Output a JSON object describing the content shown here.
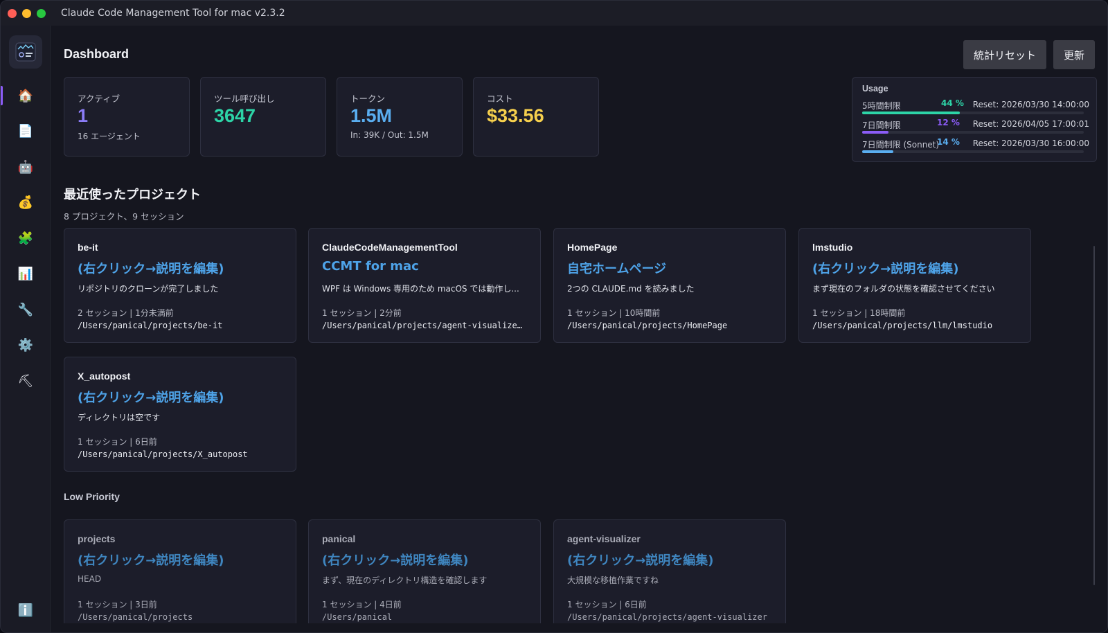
{
  "window": {
    "title": "Claude Code Management Tool for mac v2.3.2",
    "traffic_lights": {
      "close": "#ff5f57",
      "minimize": "#febc2e",
      "zoom": "#28c840"
    }
  },
  "sidebar": {
    "items": [
      {
        "icon": "home-icon",
        "glyph": "🏠",
        "active": true
      },
      {
        "icon": "document-icon",
        "glyph": "📄"
      },
      {
        "icon": "robot-icon",
        "glyph": "🤖"
      },
      {
        "icon": "money-bag-icon",
        "glyph": "💰"
      },
      {
        "icon": "puzzle-icon",
        "glyph": "🧩"
      },
      {
        "icon": "bar-chart-icon",
        "glyph": "📊"
      },
      {
        "icon": "wrench-icon",
        "glyph": "🔧"
      },
      {
        "icon": "gear-icon",
        "glyph": "⚙️"
      },
      {
        "icon": "hammer-pick-icon",
        "glyph": "⛏"
      }
    ],
    "info": {
      "icon": "info-icon",
      "glyph": "ℹ️"
    }
  },
  "header": {
    "title": "Dashboard",
    "reset_stats_label": "統計リセット",
    "refresh_label": "更新"
  },
  "stats": {
    "active": {
      "label": "アクティブ",
      "value": "1",
      "sub": "16 エージェント",
      "color": "#8b7cf6"
    },
    "tool_calls": {
      "label": "ツール呼び出し",
      "value": "3647",
      "color": "#2dd4a7"
    },
    "tokens": {
      "label": "トークン",
      "value": "1.5M",
      "sub": "In: 39K / Out: 1.5M",
      "color": "#5aaef0"
    },
    "cost": {
      "label": "コスト",
      "value": "$33.56",
      "color": "#f6d04d"
    }
  },
  "usage": {
    "title": "Usage",
    "rows": [
      {
        "label": "5時間制限",
        "percent_text": "44 %",
        "percent": 44,
        "reset": "Reset: 2026/03/30 14:00:00",
        "color": "#2dd4a7"
      },
      {
        "label": "7日間制限",
        "percent_text": "12 %",
        "percent": 12,
        "reset": "Reset: 2026/04/05 17:00:01",
        "color": "#8b5cf6"
      },
      {
        "label": "7日間制限 (Sonnet)",
        "percent_text": "14 %",
        "percent": 14,
        "reset": "Reset: 2026/03/30 16:00:00",
        "color": "#5aaef0"
      }
    ]
  },
  "recent": {
    "title": "最近使ったプロジェクト",
    "subtitle": "8 プロジェクト、9 セッション",
    "projects": [
      {
        "name": "be-it",
        "description": "(右クリック→説明を編集)",
        "message": "リポジトリのクローンが完了しました",
        "meta": "2 セッション | 1分未満前",
        "path": "/Users/panical/projects/be-it"
      },
      {
        "name": "ClaudeCodeManagementTool",
        "description": "CCMT for mac",
        "message": "WPF は Windows 専用のため macOS では動作し...",
        "meta": "1 セッション | 2分前",
        "path": "/Users/panical/projects/agent-visualize…"
      },
      {
        "name": "HomePage",
        "description": "自宅ホームページ",
        "message": "2つの CLAUDE.md を読みました",
        "meta": "1 セッション | 10時間前",
        "path": "/Users/panical/projects/HomePage"
      },
      {
        "name": "lmstudio",
        "description": "(右クリック→説明を編集)",
        "message": "まず現在のフォルダの状態を確認させてください",
        "meta": "1 セッション | 18時間前",
        "path": "/Users/panical/projects/llm/lmstudio"
      },
      {
        "name": "X_autopost",
        "description": "(右クリック→説明を編集)",
        "message": "ディレクトリは空です",
        "meta": "1 セッション | 6日前",
        "path": "/Users/panical/projects/X_autopost"
      }
    ]
  },
  "low_priority": {
    "title": "Low Priority",
    "projects": [
      {
        "name": "projects",
        "description": "(右クリック→説明を編集)",
        "message": "HEAD",
        "meta": "1 セッション | 3日前",
        "path": "/Users/panical/projects"
      },
      {
        "name": "panical",
        "description": "(右クリック→説明を編集)",
        "message": "まず、現在のディレクトリ構造を確認します",
        "meta": "1 セッション | 4日前",
        "path": "/Users/panical"
      },
      {
        "name": "agent-visualizer",
        "description": "(右クリック→説明を編集)",
        "message": "大規模な移植作業ですね",
        "meta": "1 セッション | 6日前",
        "path": "/Users/panical/projects/agent-visualizer"
      }
    ]
  }
}
